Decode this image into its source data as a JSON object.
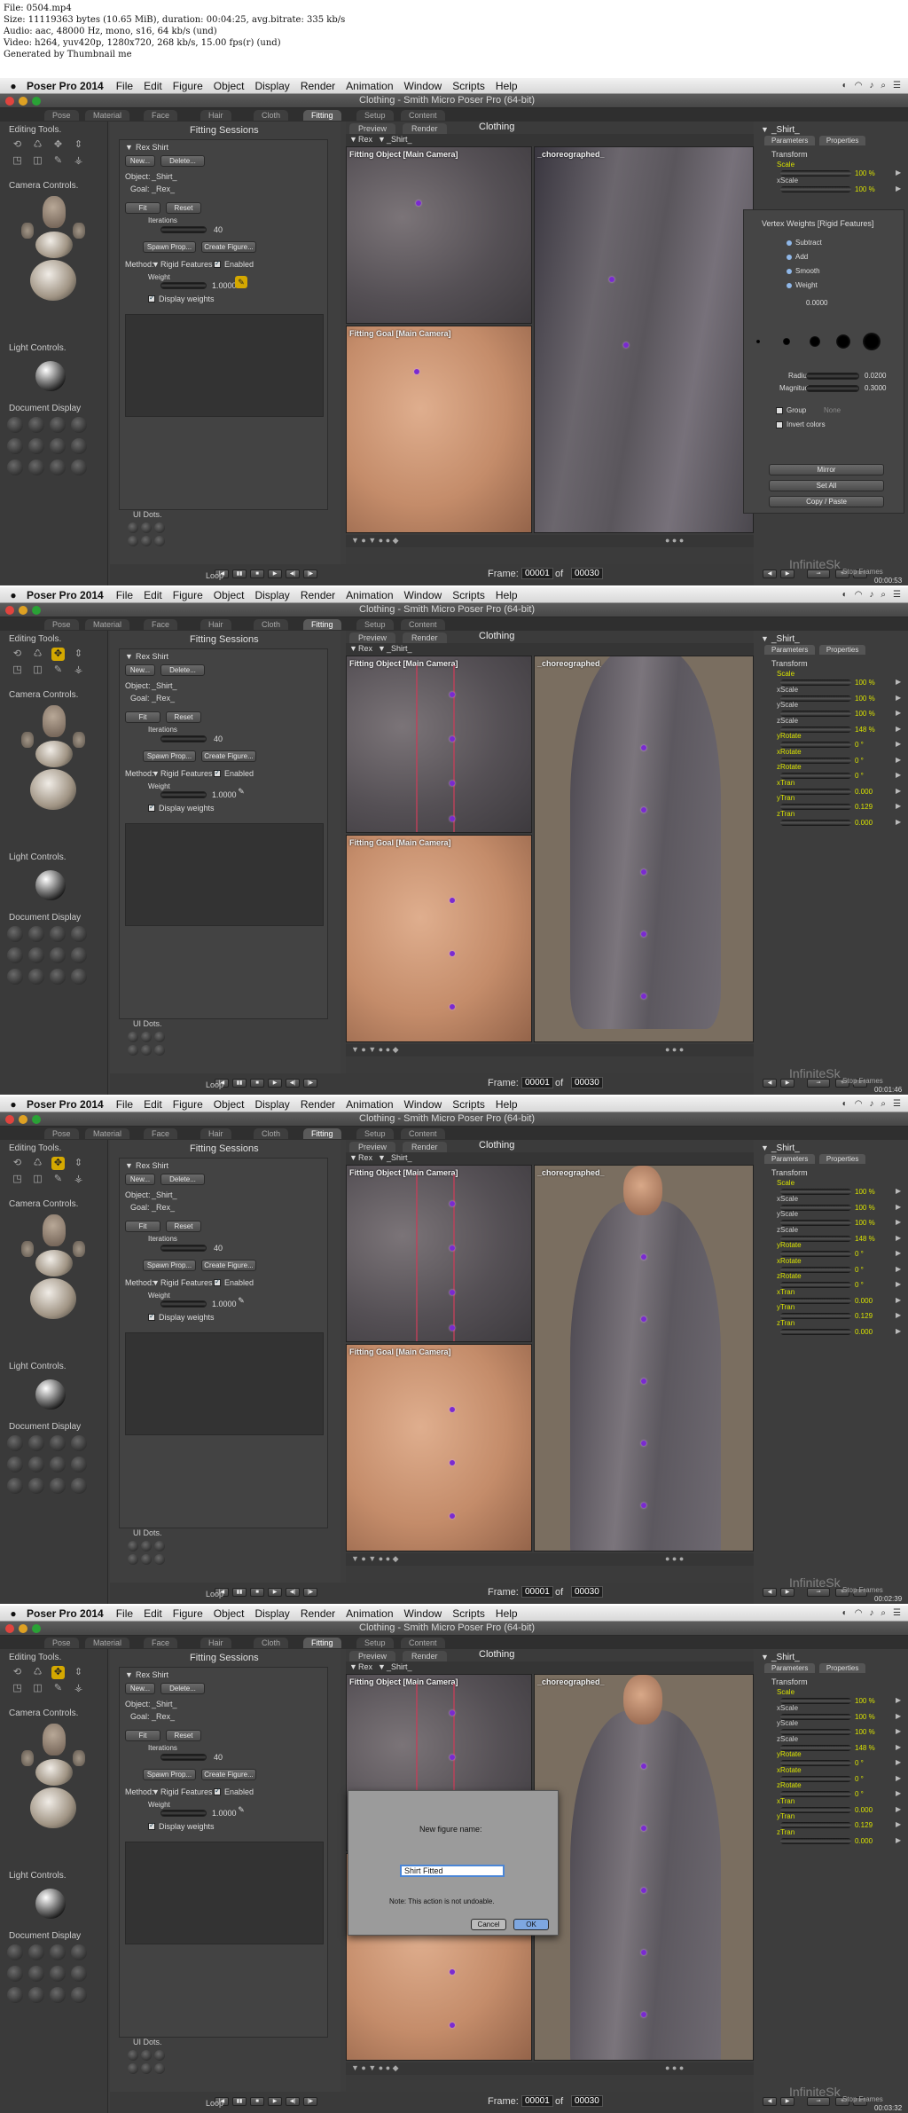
{
  "info": {
    "lines": [
      "File: 0504.mp4",
      "Size: 11119363 bytes (10.65 MiB), duration: 00:04:25, avg.bitrate: 335 kb/s",
      "Audio: aac, 48000 Hz, mono, s16, 64 kb/s (und)",
      "Video: h264, yuv420p, 1280x720, 268 kb/s, 15.00 fps(r) (und)",
      "Generated by Thumbnail me"
    ]
  },
  "app": {
    "apple": "",
    "name": "Poser Pro 2014",
    "menus": [
      "File",
      "Edit",
      "Figure",
      "Object",
      "Display",
      "Render",
      "Animation",
      "Window",
      "Scripts",
      "Help"
    ],
    "title": "Clothing - Smith Micro Poser Pro  (64-bit)",
    "rooms": [
      "Pose",
      "Material",
      "Face",
      "Hair",
      "Cloth",
      "Fitting",
      "Setup",
      "Content"
    ]
  },
  "left": {
    "editing": "Editing Tools.",
    "camera": "Camera Controls.",
    "light": "Light Controls.",
    "document": "Document Display",
    "uidots": "UI Dots.",
    "loop": "Loop"
  },
  "fitting": {
    "title": "Fitting Sessions",
    "session": "Rex Shirt",
    "new": "New...",
    "delete": "Delete...",
    "object_label": "Object:",
    "object_val": "_Shirt_",
    "goal_label": "Goal:",
    "goal_val": "_Rex_",
    "fit": "Fit",
    "reset": "Reset",
    "iterations_label": "Iterations",
    "iterations_val": "40",
    "spawn": "Spawn Prop...",
    "create": "Create Figure...",
    "method_label": "Method:",
    "method_val": "Rigid Features",
    "enabled": "Enabled",
    "weight_label": "Weight",
    "weight_val": "1.0000",
    "display_weights": "Display weights"
  },
  "doc": {
    "tabs": [
      "Preview",
      "Render"
    ],
    "room_label": "Clothing",
    "figure_sel": "Rex",
    "object_sel": "_Shirt_",
    "vp_object": "Fitting Object [Main Camera]",
    "vp_goal": "Fitting Goal [Main Camera]",
    "vp_main": "_choreographed_",
    "frame_label": "Frame:",
    "frame_cur": "00001",
    "frame_of": "of",
    "frame_total": "00030"
  },
  "right": {
    "figure": "_Shirt_",
    "tabs": [
      "Parameters",
      "Properties"
    ],
    "group": "Transform",
    "params": [
      {
        "name": "Scale",
        "value": "100 %"
      },
      {
        "name": "xScale",
        "value": "100 %"
      },
      {
        "name": "yScale",
        "value": "100 %"
      },
      {
        "name": "zScale",
        "value": "148 %"
      },
      {
        "name": "yRotate",
        "value": "0 °"
      },
      {
        "name": "xRotate",
        "value": "0 °"
      },
      {
        "name": "zRotate",
        "value": "0 °"
      },
      {
        "name": "xTran",
        "value": "0.000"
      },
      {
        "name": "yTran",
        "value": "0.129"
      },
      {
        "name": "zTran",
        "value": "0.000"
      }
    ]
  },
  "vw": {
    "title": "Vertex Weights [Rigid Features]",
    "modes": [
      "Subtract",
      "Add",
      "Smooth",
      "Weight"
    ],
    "weight": "0.0000",
    "radius_label": "Radius",
    "radius_val": "0.0200",
    "magnitude_label": "Magnitude",
    "magnitude_val": "0.3000",
    "group": "Group",
    "none": "None",
    "invert": "Invert colors",
    "mirror": "Mirror",
    "setall": "Set All",
    "copypaste": "Copy / Paste"
  },
  "dialog": {
    "prompt": "New figure name:",
    "value": "Shirt Fitted",
    "note": "Note: This action is not undoable.",
    "cancel": "Cancel",
    "ok": "OK"
  },
  "watermark": "InfiniteSk",
  "stop_frames": "Stop Frames",
  "timecodes": [
    "00:00:53",
    "00:01:46",
    "00:02:39",
    "00:03:32"
  ],
  "colors": {
    "accent_yellow": "#d4a800",
    "param_yellow": "#d8e100",
    "weight_dot": "#7a2bd0"
  }
}
